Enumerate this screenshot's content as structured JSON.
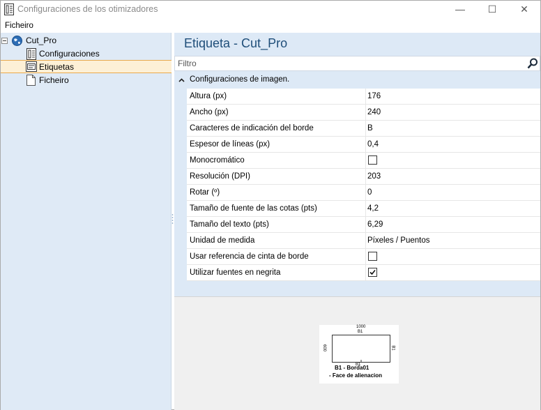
{
  "window": {
    "title": "Configuraciones de los otimizadores",
    "buttons": {
      "minimize": "—",
      "maximize": "☐",
      "close": "✕"
    }
  },
  "menu": {
    "items": [
      {
        "label": "Ficheiro"
      }
    ]
  },
  "tree": {
    "root": {
      "label": "Cut_Pro",
      "expander": "⊟"
    },
    "children": [
      {
        "label": "Configuraciones",
        "icon": "optimizer-icon"
      },
      {
        "label": "Etiquetas",
        "icon": "label-icon",
        "selected": true
      },
      {
        "label": "Ficheiro",
        "icon": "file-icon"
      }
    ]
  },
  "panel": {
    "title": "Etiqueta - Cut_Pro",
    "filter_placeholder": "Filtro"
  },
  "grid": {
    "category": "Configuraciones de imagen.",
    "rows": [
      {
        "name": "Altura (px)",
        "value": "176"
      },
      {
        "name": "Ancho (px)",
        "value": "240"
      },
      {
        "name": "Caracteres de indicación del borde",
        "value": "B"
      },
      {
        "name": "Espesor de líneas (px)",
        "value": "0,4"
      },
      {
        "name": "Monocromático",
        "checked": false
      },
      {
        "name": "Resolución (DPI)",
        "value": "203"
      },
      {
        "name": "Rotar (º)",
        "value": "0"
      },
      {
        "name": "Tamaño de fuente de las cotas (pts)",
        "value": "4,2"
      },
      {
        "name": "Tamaño del texto (pts)",
        "value": "6,29"
      },
      {
        "name": "Unidad de medida",
        "value": "Píxeles / Puentos"
      },
      {
        "name": "Usar referencia de cinta de borde",
        "checked": false
      },
      {
        "name": "Utilizar fuentes en negrita",
        "checked": true
      }
    ]
  },
  "preview": {
    "top_dim": "1000",
    "top_edge": "B1",
    "left_dim": "600",
    "right_edge": "B1",
    "bottom_edge": "B1",
    "name": "B1 - Borda01",
    "face": "- Face de alienacion"
  },
  "colors": {
    "accent": "#1f4e79",
    "panel_bg": "#dde9f6",
    "tree_bg": "#dfeaf6",
    "selection": "#fdf0d6",
    "selection_border": "#e9a94c"
  }
}
